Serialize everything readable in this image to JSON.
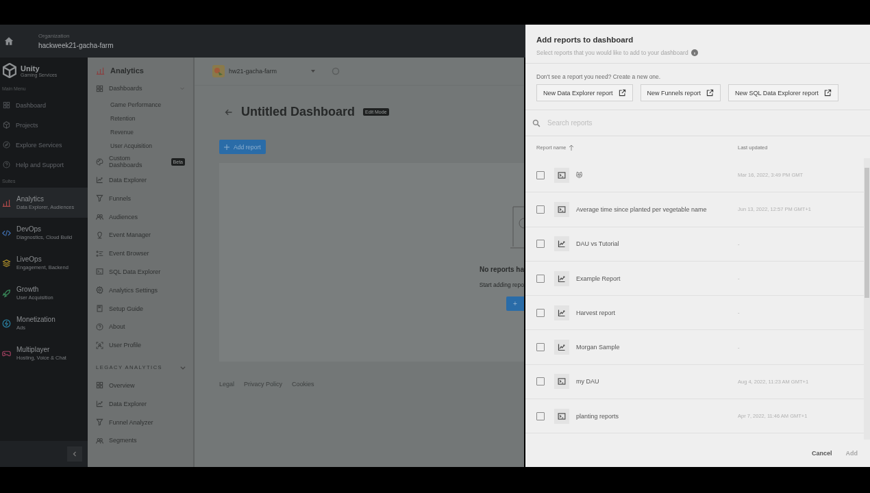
{
  "topbar": {
    "org_label": "Organization",
    "org_name": "hackweek21-gacha-farm"
  },
  "nav": {
    "brand": "Unity",
    "brand_sub": "Gaming Services",
    "main_heading": "Main Menu",
    "main_items": [
      {
        "label": "Dashboard"
      },
      {
        "label": "Projects"
      },
      {
        "label": "Explore Services"
      },
      {
        "label": "Help and Support"
      }
    ],
    "suites_heading": "Suites",
    "suites": [
      {
        "label": "Analytics",
        "sub": "Data Explorer, Audiences",
        "selected": true
      },
      {
        "label": "DevOps",
        "sub": "Diagnostics, Cloud Build",
        "selected": false
      },
      {
        "label": "LiveOps",
        "sub": "Engagement, Backend",
        "selected": false
      },
      {
        "label": "Growth",
        "sub": "User Acquisition",
        "selected": false
      },
      {
        "label": "Monetization",
        "sub": "Ads",
        "selected": false
      },
      {
        "label": "Multiplayer",
        "sub": "Hosting, Voice & Chat",
        "selected": false
      }
    ]
  },
  "sidebar": {
    "title": "Analytics",
    "items": [
      {
        "label": "Dashboards",
        "expanded": true,
        "children": [
          {
            "label": "Game Performance"
          },
          {
            "label": "Retention"
          },
          {
            "label": "Revenue"
          },
          {
            "label": "User Acquisition"
          }
        ]
      },
      {
        "label": "Custom Dashboards",
        "badge": "Beta"
      },
      {
        "label": "Data Explorer"
      },
      {
        "label": "Funnels"
      },
      {
        "label": "Audiences"
      },
      {
        "label": "Event Manager"
      },
      {
        "label": "Event Browser"
      },
      {
        "label": "SQL Data Explorer"
      },
      {
        "label": "Analytics Settings"
      },
      {
        "label": "Setup Guide"
      },
      {
        "label": "About"
      },
      {
        "label": "User Profile"
      }
    ],
    "legacy_heading": "LEGACY ANALYTICS",
    "legacy_expanded": true,
    "legacy_items": [
      {
        "label": "Overview"
      },
      {
        "label": "Data Explorer"
      },
      {
        "label": "Funnel Analyzer"
      },
      {
        "label": "Segments"
      }
    ]
  },
  "main": {
    "project": "hw21-gacha-farm",
    "title": "Untitled Dashboard",
    "mode_badge": "Edit Mode",
    "add_button": "Add report",
    "empty_title": "No reports ha",
    "empty_text": "Start adding repo",
    "empty_button": "+",
    "footer_links": [
      "Legal",
      "Privacy Policy",
      "Cookies"
    ]
  },
  "modal": {
    "title": "Add reports to dashboard",
    "subtitle": "Select reports that you would like to add to your dashboard",
    "prompt": "Don't see a report you need? Create a new one.",
    "new_buttons": [
      "New Data Explorer report",
      "New Funnels report",
      "New SQL Data Explorer report"
    ],
    "search": {
      "placeholder": "Search reports"
    },
    "columns": [
      "Report name",
      "Last updated"
    ],
    "rows": [
      {
        "kind": "sql",
        "name": "😻",
        "updated": "Mar 16, 2022, 3:49 PM GMT",
        "checked": false
      },
      {
        "kind": "sql",
        "name": "Average time since planted per vegetable name",
        "updated": "Jun 13, 2022, 12:57 PM GMT+1",
        "checked": false
      },
      {
        "kind": "chart",
        "name": "DAU vs Tutorial",
        "updated": "-",
        "checked": false
      },
      {
        "kind": "chart",
        "name": "Example Report",
        "updated": "-",
        "checked": false
      },
      {
        "kind": "chart",
        "name": "Harvest report",
        "updated": "-",
        "checked": false
      },
      {
        "kind": "chart",
        "name": "Morgan Sample",
        "updated": "-",
        "checked": false
      },
      {
        "kind": "sql",
        "name": "my DAU",
        "updated": "Aug 4, 2022, 11:23 AM GMT+1",
        "checked": false
      },
      {
        "kind": "sql",
        "name": "planting reports",
        "updated": "Apr 7, 2022, 11:46 AM GMT+1",
        "checked": false
      }
    ],
    "cancel": "Cancel",
    "add": {
      "label": "Add",
      "disabled": true
    }
  }
}
